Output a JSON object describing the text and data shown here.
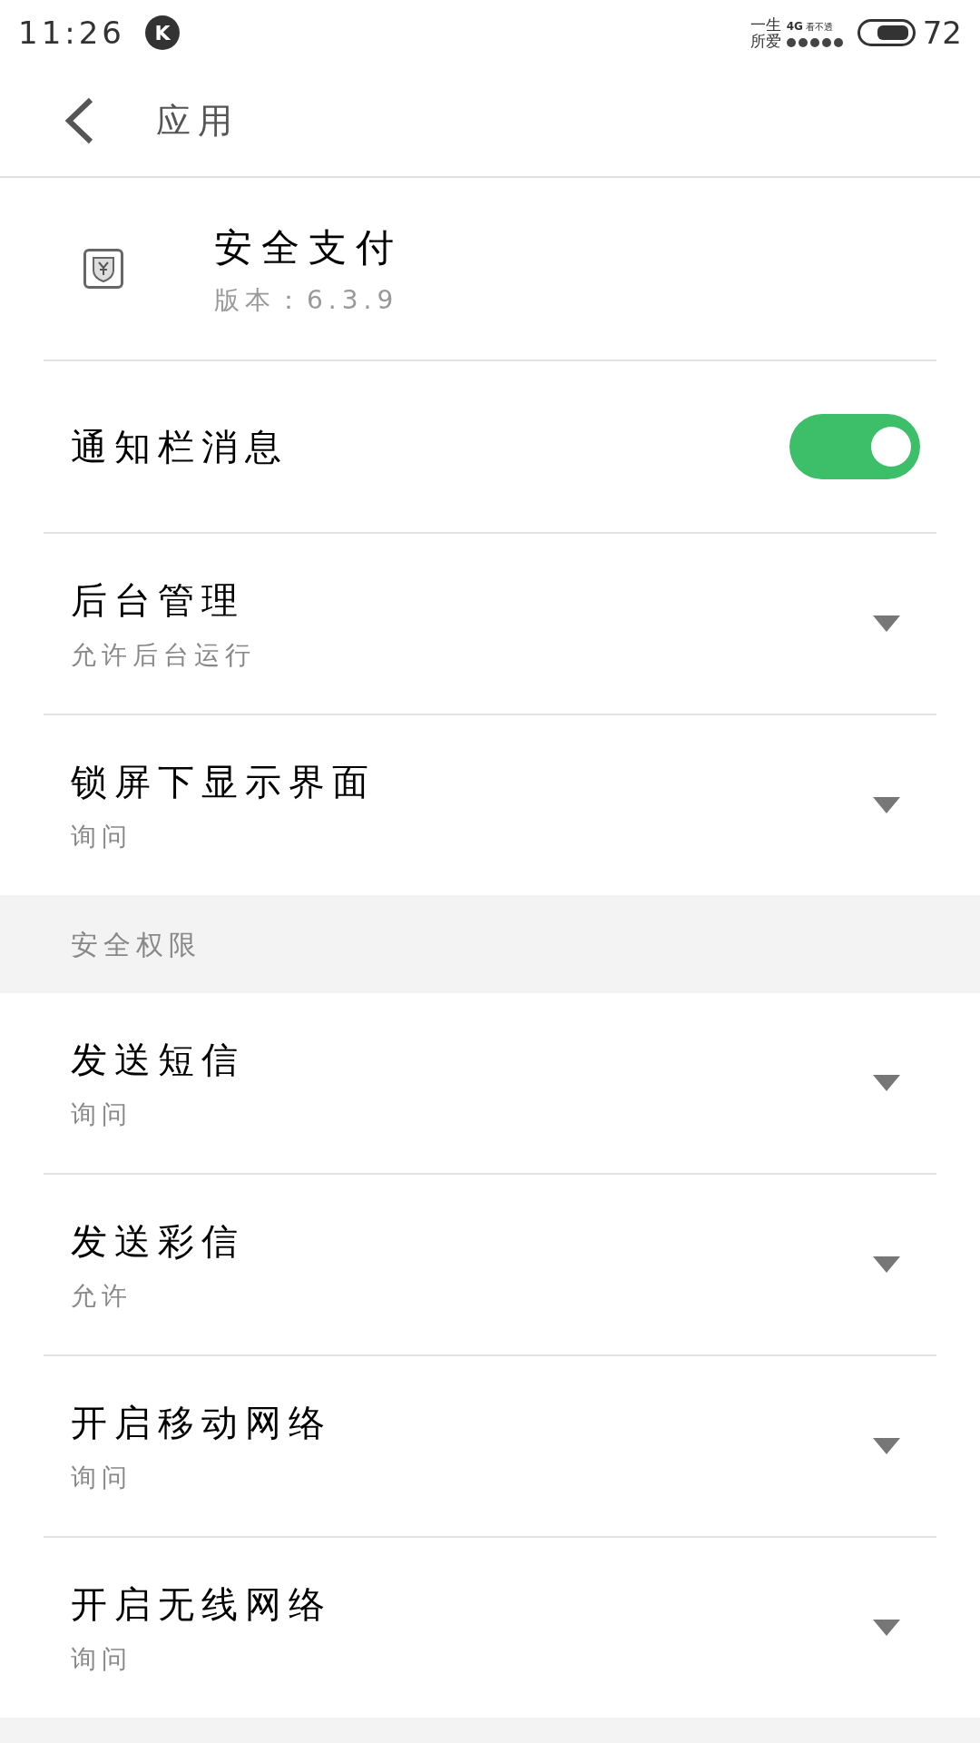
{
  "status_bar": {
    "time": "11:26",
    "badge": "K",
    "carrier": [
      "一生",
      "所爱"
    ],
    "network": "4G",
    "network_note": "看不透",
    "battery": "72"
  },
  "header": {
    "title": "应用"
  },
  "app": {
    "name": "安全支付",
    "version": "版本：6.3.9"
  },
  "settings": [
    {
      "kind": "toggle",
      "title": "通知栏消息",
      "on": true
    },
    {
      "kind": "dropdown",
      "title": "后台管理",
      "value": "允许后台运行"
    },
    {
      "kind": "dropdown",
      "title": "锁屏下显示界面",
      "value": "询问"
    }
  ],
  "section": {
    "title": "安全权限"
  },
  "permissions": [
    {
      "title": "发送短信",
      "value": "询问"
    },
    {
      "title": "发送彩信",
      "value": "允许"
    },
    {
      "title": "开启移动网络",
      "value": "询问"
    },
    {
      "title": "开启无线网络",
      "value": "询问"
    }
  ]
}
